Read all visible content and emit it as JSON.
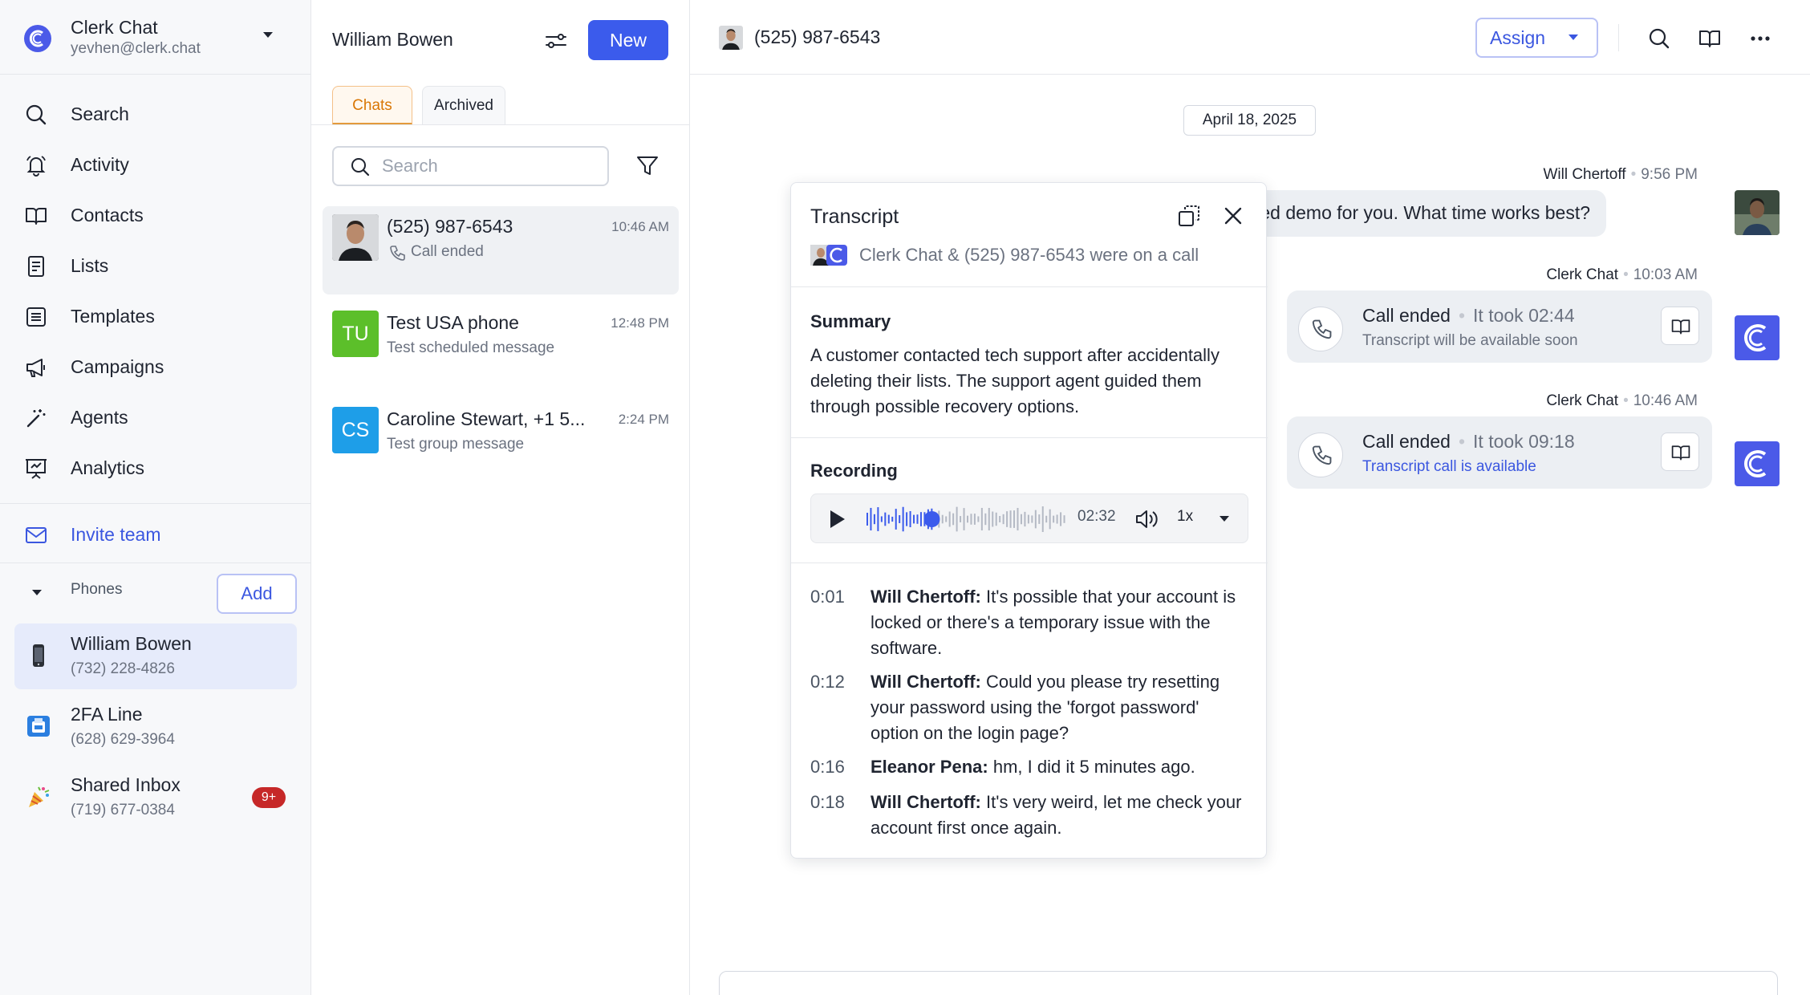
{
  "sidebar": {
    "account": {
      "name": "Clerk Chat",
      "email": "yevhen@clerk.chat"
    },
    "nav": [
      {
        "label": "Search",
        "icon": "search-icon"
      },
      {
        "label": "Activity",
        "icon": "bell-icon"
      },
      {
        "label": "Contacts",
        "icon": "book-icon"
      },
      {
        "label": "Lists",
        "icon": "list-icon"
      },
      {
        "label": "Templates",
        "icon": "template-icon"
      },
      {
        "label": "Campaigns",
        "icon": "megaphone-icon"
      },
      {
        "label": "Agents",
        "icon": "wand-icon"
      },
      {
        "label": "Analytics",
        "icon": "presentation-icon"
      }
    ],
    "invite": {
      "label": "Invite team",
      "icon": "mail-icon"
    },
    "phones_label": "Phones",
    "add_label": "Add",
    "phones": [
      {
        "name": "William Bowen",
        "number": "(732) 228-4826",
        "icon": "mobile-phone-icon"
      },
      {
        "name": "2FA Line",
        "number": "(628) 629-3964",
        "icon": "fax-icon"
      },
      {
        "name": "Shared Inbox",
        "number": "(719) 677-0384",
        "icon": "party-popper-icon",
        "badge": "9+"
      }
    ]
  },
  "list": {
    "title": "William Bowen",
    "new_label": "New",
    "tabs": [
      "Chats",
      "Archived"
    ],
    "search_placeholder": "Search",
    "conversations": [
      {
        "name": "(525) 987-6543",
        "time": "10:46 AM",
        "preview": "Call ended",
        "avatar": "photo"
      },
      {
        "name": "Test USA phone",
        "time": "12:48 PM",
        "preview": "Test scheduled message",
        "initials": "TU",
        "color": "#5cbf2a"
      },
      {
        "name": "Caroline Stewart, +1 5...",
        "time": "2:24 PM",
        "preview": "Test group message",
        "initials": "CS",
        "color": "#1e9ee8"
      }
    ]
  },
  "main": {
    "header_title": "(525) 987-6543",
    "assign_label": "Assign",
    "date": "April 18, 2025",
    "messages": [
      {
        "sender": "Will Chertoff",
        "time": "9:56 PM",
        "text": "a personalized demo for you. What time works best?"
      },
      {
        "sender": "Clerk Chat",
        "time": "10:03 AM",
        "call_title": "Call ended",
        "duration": "It took 02:44",
        "sub": "Transcript will be available soon"
      },
      {
        "sender": "Clerk Chat",
        "time": "10:46 AM",
        "call_title": "Call ended",
        "duration": "It took 09:18",
        "sub": "Transcript call is available"
      }
    ]
  },
  "transcript": {
    "title": "Transcript",
    "subtitle": "Clerk Chat & (525) 987-6543 were on a call",
    "summary_title": "Summary",
    "summary": "A customer contacted tech support after accidentally deleting their lists. The support agent guided them through possible recovery options.",
    "recording_title": "Recording",
    "player": {
      "time": "02:32",
      "speed": "1x",
      "progress": 0.33
    },
    "lines": [
      {
        "ts": "0:01",
        "speaker": "Will Chertoff:",
        "text": "It's possible that your account is locked or there's a temporary issue with the software."
      },
      {
        "ts": "0:12",
        "speaker": "Will Chertoff:",
        "text": "Could you please try resetting your password using the 'forgot password' option on the login page?"
      },
      {
        "ts": "0:16",
        "speaker": "Eleanor Pena:",
        "text": "hm, I did it 5 minutes ago."
      },
      {
        "ts": "0:18",
        "speaker": "Will Chertoff:",
        "text": "It's very weird, let me check your account first once again."
      }
    ]
  },
  "colors": {
    "accent": "#3b5bec",
    "brand": "#4b5ae8",
    "tab_active": "#e39a3c",
    "badge": "#c62828"
  }
}
